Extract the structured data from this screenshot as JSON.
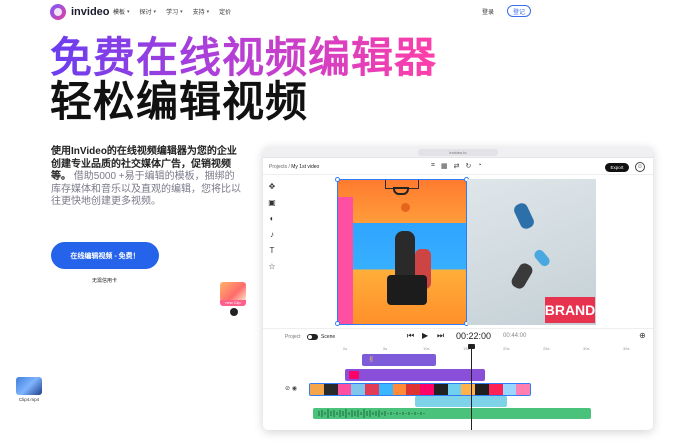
{
  "nav": {
    "brand": "invideo",
    "items": [
      {
        "label": "模板"
      },
      {
        "label": "探讨"
      },
      {
        "label": "学习"
      },
      {
        "label": "支持"
      },
      {
        "label": "定价"
      }
    ],
    "login": "登录",
    "signup": "登记"
  },
  "hero": {
    "title_line1": "免费在线视频编辑器",
    "title_line2": "轻松编辑视频",
    "desc_strong": "使用InVideo的在线视频编辑器为您的企业创建专业品质的社交媒体广告，促销视频等。",
    "desc_muted": "借助5000 +易于编辑的模板，捆绑的库存媒体和音乐以及直观的编辑，您将比以往更快地创建更多视频。",
    "cta": "在线编辑视频 - 免费！",
    "no_card": "无需信用卡"
  },
  "floating": {
    "new_clip": "new Clip",
    "clip4": "Clip4.mp4"
  },
  "editor": {
    "url": "invideo.io",
    "crumb_root": "Projects",
    "crumb_sep": "/",
    "crumb_project": "My 1st video",
    "export": "Export",
    "brand_text": "BRAND",
    "project_label": "Project",
    "scene_label": "Scene",
    "time_current": "00:22:00",
    "time_total": "00:44:00",
    "ruler": [
      "0s",
      "5s",
      "10s",
      "15s",
      "20s",
      "25s",
      "30s",
      "35s",
      "40s"
    ]
  },
  "colors": {
    "accent": "#2563eb",
    "gradient_start": "#6a3df0",
    "gradient_end": "#ff3fa8",
    "track_purple": "#7e5bd8",
    "track_cyan": "#7fd3e8",
    "track_green": "#4bc27b"
  },
  "icons": [
    "move-icon",
    "image-icon",
    "palette-icon",
    "music-icon",
    "text-icon",
    "sticker-icon",
    "play-icon",
    "zoom-icon",
    "user-icon",
    "lock-icon",
    "eye-icon"
  ]
}
